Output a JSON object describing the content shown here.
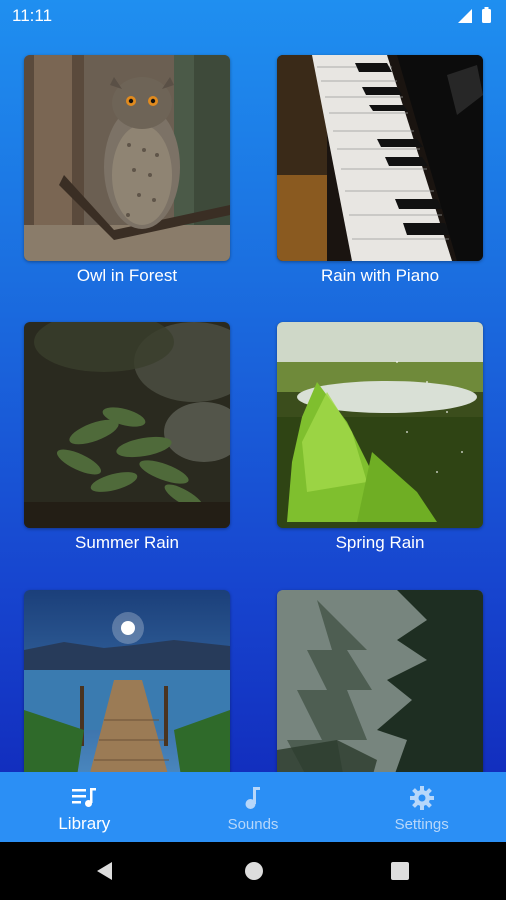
{
  "status_bar": {
    "time": "11:11"
  },
  "cards": [
    {
      "title": "Owl in Forest",
      "thumb": "owl-forest"
    },
    {
      "title": "Rain with Piano",
      "thumb": "piano-keys"
    },
    {
      "title": "Summer Rain",
      "thumb": "fern-forest"
    },
    {
      "title": "Spring Rain",
      "thumb": "green-conifer"
    },
    {
      "title": "",
      "thumb": "lake-pier-moon"
    },
    {
      "title": "",
      "thumb": "misty-pine-forest"
    }
  ],
  "bottom_nav": {
    "items": [
      {
        "label": "Library",
        "icon": "library-music-icon",
        "active": true
      },
      {
        "label": "Sounds",
        "icon": "music-note-icon",
        "active": false
      },
      {
        "label": "Settings",
        "icon": "gear-icon",
        "active": false
      }
    ]
  },
  "colors": {
    "bg_top": "#1f8ff0",
    "bg_bottom": "#0f1fb3",
    "nav_bg": "#2b8ff5",
    "nav_inactive": "#b7d7fa"
  }
}
